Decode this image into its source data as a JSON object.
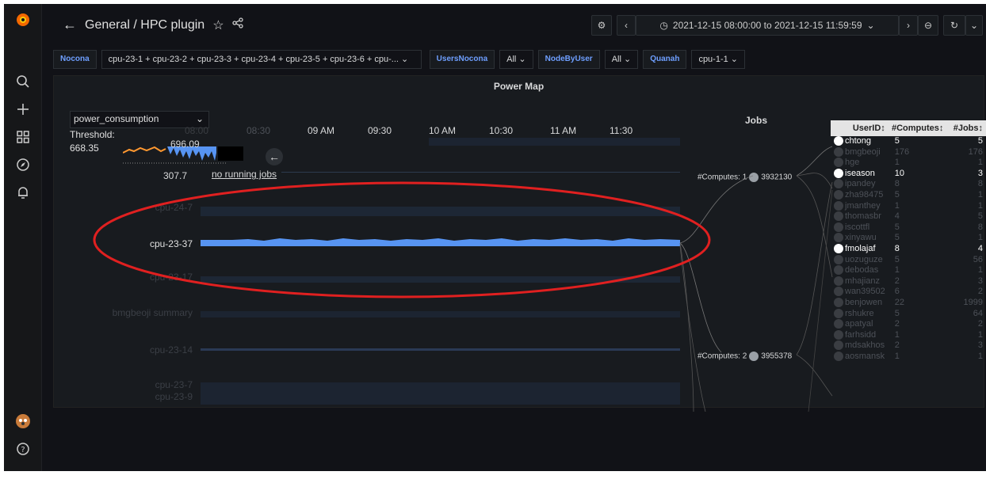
{
  "breadcrumb": "General / HPC plugin",
  "time_range": "2021-12-15 08:00:00 to 2021-12-15 11:59:59",
  "variables": [
    {
      "label": "Nocona",
      "value": "cpu-23-1 + cpu-23-2 + cpu-23-3 + cpu-23-4 + cpu-23-5 + cpu-23-6 + cpu-..."
    },
    {
      "label": "UsersNocona",
      "value": "All"
    },
    {
      "label": "NodeByUser",
      "value": "All"
    },
    {
      "label": "Quanah",
      "value": "cpu-1-1"
    }
  ],
  "panel": {
    "title": "Power Map",
    "metric": "power_consumption",
    "threshold_label": "Threshold:",
    "threshold_value": "668.35",
    "legend_max": "696.09",
    "legend_min": "307.7",
    "no_jobs": "no running jobs",
    "time_labels": [
      "08:30",
      "09 AM",
      "09:30",
      "10 AM",
      "10:30",
      "11 AM",
      "11:30"
    ],
    "time_faint": "08:00",
    "rows": [
      "cpu-24-7",
      "cpu-23-37",
      "cpu-23-17",
      "bmgbeoji summary",
      "cpu-23-14",
      "cpu-23-7",
      "cpu-23-9"
    ],
    "jobs_title": "Jobs",
    "jobs": [
      {
        "prefix": "#Computes: 1",
        "id": "3932130"
      },
      {
        "prefix": "#Computes: 2",
        "id": "3955378"
      }
    ]
  },
  "users_table": {
    "headers": [
      "UserID↕",
      "#Computes↕",
      "#Jobs↕"
    ],
    "rows": [
      {
        "user": "chtong",
        "computes": "5",
        "jobs": "5",
        "highlight": true
      },
      {
        "user": "bmgbeoji",
        "computes": "176",
        "jobs": "176",
        "highlight": false
      },
      {
        "user": "hge",
        "computes": "1",
        "jobs": "1",
        "highlight": false
      },
      {
        "user": "iseason",
        "computes": "10",
        "jobs": "3",
        "highlight": true
      },
      {
        "user": "ipandey",
        "computes": "8",
        "jobs": "8",
        "highlight": false
      },
      {
        "user": "zha98475",
        "computes": "5",
        "jobs": "1",
        "highlight": false
      },
      {
        "user": "jmanthey",
        "computes": "1",
        "jobs": "1",
        "highlight": false
      },
      {
        "user": "thomasbr",
        "computes": "4",
        "jobs": "5",
        "highlight": false
      },
      {
        "user": "iscottfl",
        "computes": "5",
        "jobs": "8",
        "highlight": false
      },
      {
        "user": "xinyawu",
        "computes": "5",
        "jobs": "1",
        "highlight": false
      },
      {
        "user": "fmolajaf",
        "computes": "8",
        "jobs": "4",
        "highlight": true
      },
      {
        "user": "uozuguze",
        "computes": "5",
        "jobs": "56",
        "highlight": false
      },
      {
        "user": "debodas",
        "computes": "1",
        "jobs": "1",
        "highlight": false
      },
      {
        "user": "mhajianz",
        "computes": "2",
        "jobs": "3",
        "highlight": false
      },
      {
        "user": "wan39502",
        "computes": "6",
        "jobs": "2",
        "highlight": false
      },
      {
        "user": "benjowen",
        "computes": "22",
        "jobs": "1999",
        "highlight": false
      },
      {
        "user": "rshukre",
        "computes": "5",
        "jobs": "64",
        "highlight": false
      },
      {
        "user": "apatyal",
        "computes": "2",
        "jobs": "2",
        "highlight": false
      },
      {
        "user": "farhsidd",
        "computes": "1",
        "jobs": "1",
        "highlight": false
      },
      {
        "user": "mdsakhos",
        "computes": "2",
        "jobs": "3",
        "highlight": false
      },
      {
        "user": "aosmansk",
        "computes": "1",
        "jobs": "1",
        "highlight": false
      }
    ]
  },
  "colors": {
    "accent": "#6e9fff",
    "series": "#5794f2",
    "highlight_circle": "#e02020",
    "warm": "#ff9830"
  }
}
